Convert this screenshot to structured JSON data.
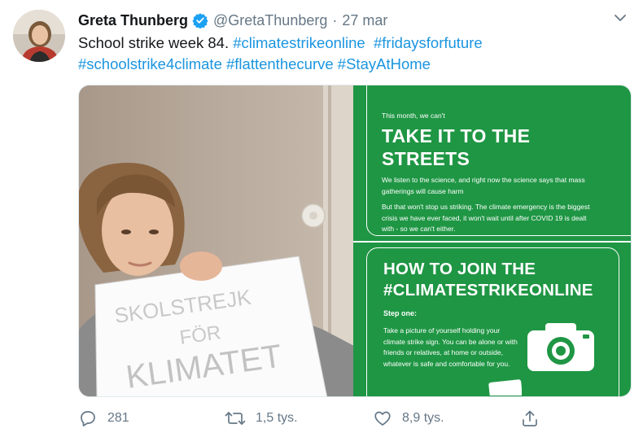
{
  "author": {
    "display_name": "Greta Thunberg",
    "handle": "@GretaThunberg",
    "separator": "·",
    "date": "27 mar"
  },
  "tweet": {
    "text_prefix": "School strike week 84. ",
    "hashtags": [
      "#climatestrikeonline",
      "#fridaysforfuture",
      "#schoolstrike4climate",
      "#flattenthecurve",
      "#StayAtHome"
    ]
  },
  "photo": {
    "sign_lines": [
      "SKOLSTREJK",
      "FÖR",
      "KLIMATET"
    ]
  },
  "graphic_top": {
    "intro": "This month, we can't",
    "headline_1": "TAKE IT TO THE",
    "headline_2": "STREETS",
    "para_1": "We listen to the science, and right now the science says that mass gatherings will cause harm",
    "para_2": "But that won't stop us striking. The climate emergency is the biggest crisis we have ever faced, it won't wait until after COVID 19 is dealt with - so we can't either."
  },
  "graphic_bottom": {
    "headline_1": "HOW TO JOIN THE",
    "headline_2": "#CLIMATESTRIKEONLINE",
    "step_label": "Step one:",
    "step_text": "Take a picture of yourself holding your climate strike sign. You can be alone or with friends or relatives, at home or outside, whatever is safe and comfortable for you."
  },
  "actions": {
    "replies": "281",
    "retweets": "1,5 tys.",
    "likes": "8,9 tys."
  },
  "icons": {
    "verified": "verified-badge-icon",
    "caret": "chevron-down-icon",
    "reply": "reply-icon",
    "retweet": "retweet-icon",
    "like": "heart-icon",
    "share": "share-icon",
    "camera": "camera-icon"
  },
  "colors": {
    "link": "#1b95e0",
    "verified": "#1da1f2",
    "graphic_green": "#1f9644",
    "muted": "#657786"
  }
}
